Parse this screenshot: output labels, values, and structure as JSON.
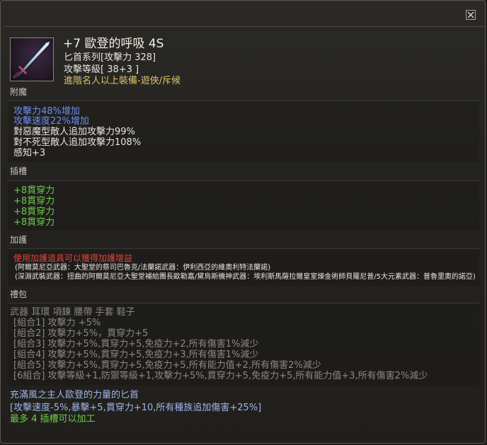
{
  "colors": {
    "title": "#f3efe6",
    "white": "#e9e5dc",
    "blue": "#6f8df0",
    "green": "#6ccb4b",
    "red": "#e0453d",
    "yellow": "#dcc36b",
    "gray": "#8c8880",
    "label": "#cbc6bb"
  },
  "close_icon": "close-x-icon",
  "item": {
    "icon": "dagger-weapon-icon",
    "name": "+7 歐登的呼吸 4S",
    "type_line": "匕首系列[攻擊力 328]",
    "level_line": "攻擊等級[ 38+3 ]",
    "requirement": "進階名人以上裝備-遊俠/斥候"
  },
  "enchant": {
    "label": "附魔",
    "lines": [
      "攻擊力48%增加",
      "攻擊速度22%增加",
      "對惡魔型敵人追加攻擊力99%",
      "對不死型敵人追加攻擊力108%",
      "感知+3"
    ]
  },
  "slots": {
    "label": "插槽",
    "lines": [
      "+8貫穿力",
      "+8貫穿力",
      "+8貫穿力",
      "+8貫穿力"
    ]
  },
  "protection": {
    "label": "加護",
    "warning": "使用加護道具可以獲得加護增益",
    "line1": "(阿爾莫尼亞武器：大聖堂的祭司巴魯克/法蘭諾武器：伊利西亞的維奧利特法蘭諾)",
    "line2": "(深淵武裝武器：扭曲的阿爾莫尼亞大聖堂補給團長歐勒嘉/黛烏斯機神武器：埃利斯馬薩拉爾皇室煉金術師貝羅尼普/5大元素武器：普魯里奧的諾亞)"
  },
  "set": {
    "label": "禮包",
    "parts": "武器 耳環 項鍊 腰帶 手套 鞋子",
    "lines": [
      "[組合1] 攻擊力 +5%",
      "[組合2] 攻擊力+5%，貫穿力+5",
      "[組合3] 攻擊力+5%,貫穿力+5,免疫力+2,所有傷害1%減少",
      "[組合4] 攻擊力+5%,貫穿力+5,免疫力+3,所有傷害1%減少",
      "[組合5] 攻擊力+5%,貫穿力+5,免疫力+5,所有能力值+2,所有傷害2%減少",
      "[6組合] 攻擊等級+1,防禦等級+1,攻擊力+5%,貫穿力+5,免疫力+5,所有能力值+3,所有傷害2%減少"
    ]
  },
  "description": {
    "line1": "充滿風之主人歐登的力量的匕首",
    "line2": "[攻擊速度-5%,暴擊+5,貫穿力+10,所有種族追加傷害+25%]",
    "line3": "最多 4 插槽可以加工"
  }
}
